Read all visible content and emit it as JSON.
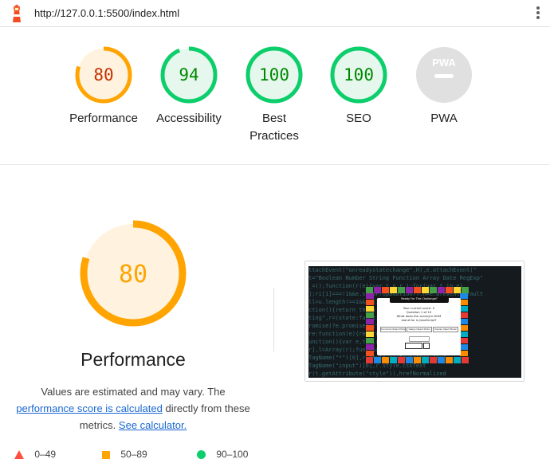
{
  "topbar": {
    "url": "http://127.0.0.1:5500/index.html"
  },
  "gauges": [
    {
      "score": "80",
      "label": "Performance",
      "level": 0.8,
      "color": "#ffa400",
      "bg": "#fff3e0",
      "text_color": "#c33300"
    },
    {
      "score": "94",
      "label": "Accessibility",
      "level": 0.94,
      "color": "#0cce6b",
      "bg": "#e6f8ee",
      "text_color": "#008800"
    },
    {
      "score": "100",
      "label": "Best Practices",
      "level": 1.0,
      "color": "#0cce6b",
      "bg": "#e6f8ee",
      "text_color": "#008800"
    },
    {
      "score": "100",
      "label": "SEO",
      "level": 1.0,
      "color": "#0cce6b",
      "bg": "#e6f8ee",
      "text_color": "#008800"
    },
    {
      "label": "PWA",
      "badge": "PWA",
      "color": "#e0e0e0"
    }
  ],
  "performance": {
    "score": "80",
    "level": 0.8,
    "title": "Performance",
    "desc_part1": "Values are estimated and may vary. The",
    "link1": "performance score is calculated",
    "desc_part2": "directly from these metrics.",
    "link2": "See calculator."
  },
  "legend": [
    {
      "range": "0–49",
      "shape": "triangle",
      "color": "#ff4e42"
    },
    {
      "range": "50–89",
      "shape": "square",
      "color": "#ffa400"
    },
    {
      "range": "90–100",
      "shape": "circle",
      "color": "#0cce6b"
    }
  ],
  "screenshot": {
    "code_lines": [
      "ttachEvent(\"onreadystatechange\",H),e.attachEvent(\"",
      "t=\"Boolean Number String Function Array Date RegExp\"",
      "_=();function(r(e){var t,n,r,i;for(var t in e)",
      "];ri[1]===!1&&e.stopPropagation(),n=e.preventDefault",
      "ll=u.length!==i&&ti[1]},lIII,((n.parentNode)",
      "ction(){return this}:function(e,t,n){var",
      "ting\",r=(state:function(){var",
      "romise)?e.promise():function()",
      "re:function(e){return this.",
      "unction(){var e,t,n,r;r.call(",
      "r],l=Array(r);function(e",
      "TagName(\"*\")[0],r.style.cssText=\"top:1px\"",
      "TagName(\"input\")[0],r.style.cssText",
      "r(t.getAttribute(\"style\")),hrefNormalized"
    ],
    "card_title": "Ready For The Challenge?",
    "card_lines": [
      "Your current score: 0",
      "Question 1 of 10",
      "What does the acronym DOM",
      "stand for in JavaScript?"
    ],
    "options": [
      "Document Object Model",
      "Design Object Model",
      "Display Object Model"
    ],
    "buttons": [
      "Next"
    ]
  }
}
